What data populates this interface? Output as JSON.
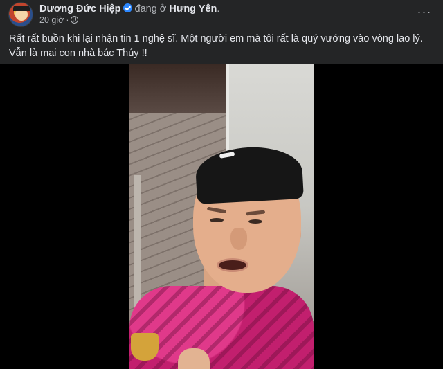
{
  "post": {
    "author": {
      "name": "Dương Đức Hiệp",
      "verified_icon": "verified-badge-icon",
      "location_prefix": "đang ở",
      "location_name": "Hưng Yên",
      "location_end": "."
    },
    "meta": {
      "time": "20 giờ",
      "separator": "·",
      "audience_icon": "globe-icon"
    },
    "more_icon": "more-options-icon",
    "more_label": "···",
    "caption": "Rất rất buồn khi lại nhận tin 1 nghệ sĩ. Một người em mà tôi rất là quý vướng vào vòng lao lý. Vẫn là mai con nhà bác Thúy !!"
  },
  "colors": {
    "background": "#242526",
    "text_primary": "#e4e6eb",
    "text_secondary": "#b0b3b8",
    "verified": "#2d88ff",
    "media_background": "#000000"
  }
}
